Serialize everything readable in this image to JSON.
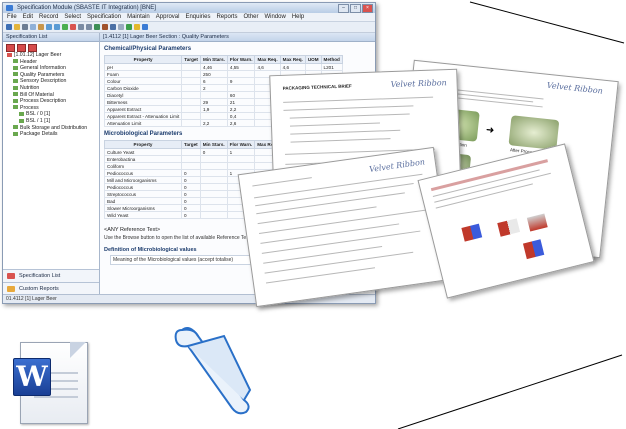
{
  "window": {
    "title": "Specification Module (SBASTE IT Integration) [BNE]",
    "menu": [
      "File",
      "Edit",
      "Record",
      "Select",
      "Specification",
      "Maintain",
      "Approval",
      "Enquiries",
      "Reports",
      "Other",
      "Window",
      "Help"
    ]
  },
  "left_pane": {
    "header": "Specification List",
    "tree": [
      {
        "label": "[1.01.12] Lager Beer",
        "level": 0
      },
      {
        "label": "Header",
        "level": 1
      },
      {
        "label": "General Information",
        "level": 1
      },
      {
        "label": "Quality Parameters",
        "level": 1
      },
      {
        "label": "Sensory Description",
        "level": 1
      },
      {
        "label": "Nutrition",
        "level": 1
      },
      {
        "label": "Bill Of Material",
        "level": 1
      },
      {
        "label": "Process Description",
        "level": 1
      },
      {
        "label": "Process",
        "level": 1
      },
      {
        "label": "BSL / 0 [1]",
        "level": 2
      },
      {
        "label": "BSL / 1 [1]",
        "level": 2
      },
      {
        "label": "Bulk Storage and Distribution",
        "level": 1
      },
      {
        "label": "Package Details",
        "level": 1
      }
    ],
    "nav": [
      {
        "label": "Specification List",
        "color": "#d9534f"
      },
      {
        "label": "Custom Reports",
        "color": "#e8a93c"
      }
    ],
    "status": "01.4112 [1] Lager Beer"
  },
  "main": {
    "header": "[1.4112 [1] Lager Beer Section : Quality Parameters",
    "chem_title": "Chemical/Physical Parameters",
    "chem_headers": [
      "Property",
      "Target",
      "Min Stars.",
      "Flor Warn.",
      "Max Req.",
      "Max Req.",
      "UOM",
      "Method"
    ],
    "chem_rows": [
      [
        "pH",
        "",
        "4,46",
        "4,55",
        "4,6",
        "4,6",
        "",
        "L201"
      ],
      [
        "Foam",
        "",
        "250",
        "",
        "",
        "",
        "",
        ""
      ],
      [
        "Colour",
        "",
        "6",
        "9",
        "",
        "",
        "",
        ""
      ],
      [
        "Carbon Dioxide",
        "",
        "2",
        "",
        "",
        "",
        "",
        ""
      ],
      [
        "Diacetyl",
        "",
        "",
        "60",
        "",
        "",
        "",
        ""
      ],
      [
        "Bitterness",
        "",
        "29",
        "21",
        "",
        "",
        "",
        ""
      ],
      [
        "Apparent Extract",
        "",
        "1,9",
        "2,2",
        "",
        "",
        "",
        ""
      ],
      [
        "Apparent Extract - Attenuation Limit",
        "",
        "",
        "0,4",
        "",
        "",
        "",
        ""
      ],
      [
        "Attenuation Limit",
        "",
        "2,2",
        "2,6",
        "",
        "",
        "",
        ""
      ]
    ],
    "micro_title": "Microbiological Parameters",
    "micro_headers": [
      "Property",
      "Target",
      "Min Stars.",
      "Flor Warn.",
      "Max Req."
    ],
    "micro_rows": [
      [
        "Culture Yeast",
        "",
        "0",
        "1",
        ""
      ],
      [
        "Enterobactina",
        "",
        "",
        "",
        ""
      ],
      [
        "Coliform",
        "",
        "",
        "",
        ""
      ],
      [
        "Pediococcus",
        "0",
        "",
        "1",
        ""
      ],
      [
        "Mill and Microorganisms",
        "0",
        "",
        "",
        ""
      ],
      [
        "Pediococcus",
        "0",
        "",
        "",
        ""
      ],
      [
        "Streptococcus",
        "0",
        "",
        "",
        ""
      ],
      [
        "Bad",
        "0",
        "",
        "",
        ""
      ],
      [
        "Slower Microorganisms",
        "0",
        "",
        "",
        ""
      ],
      [
        "Wild Yeast",
        "0",
        "",
        "",
        ""
      ]
    ],
    "ref_note": "<ANY Reference Text>",
    "ref_hint": "Use the Browse button to open the list of available Reference Texts. Sen",
    "definition_title": "Definition of Microbiological values",
    "definition_text": "Meaning of the Microbiological values (accept totalise)"
  },
  "documents": {
    "brand": "Velvet Ribbon",
    "packaging_title": "PACKAGING TECHNICAL BRIEF",
    "photo_labels": [
      "Before Lamination",
      "After Process"
    ]
  },
  "icons": {
    "word_letter": "W",
    "word_color": "#2b5cb8",
    "scroll_color": "#2a70c8"
  }
}
